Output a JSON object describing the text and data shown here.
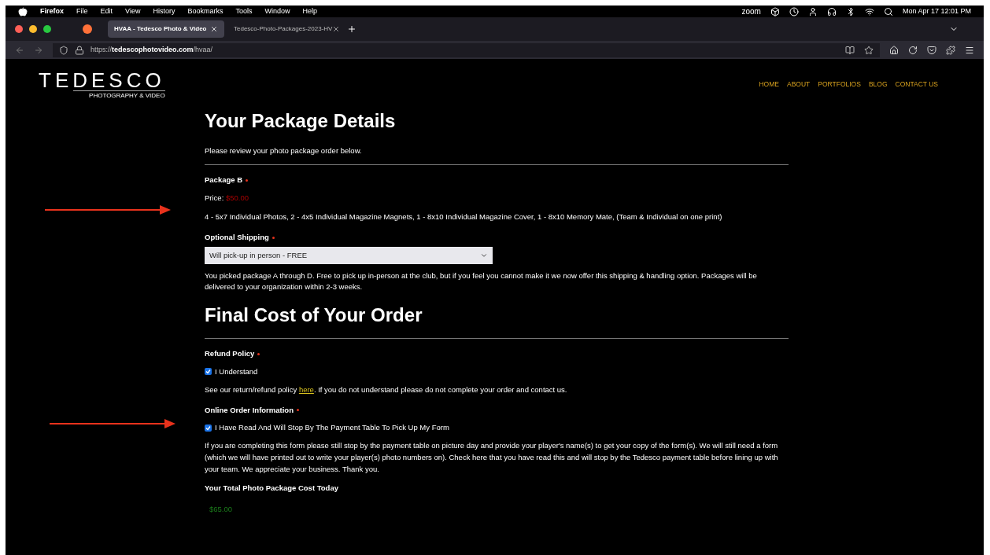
{
  "menu_bar": {
    "app": "Firefox",
    "items": [
      "File",
      "Edit",
      "View",
      "History",
      "Bookmarks",
      "Tools",
      "Window",
      "Help"
    ],
    "status_text": "zoom",
    "clock": "Mon Apr 17  12:01 PM"
  },
  "tabs": [
    {
      "label": "HVAA - Tedesco Photo & Video",
      "selected": true
    },
    {
      "label": "Tedesco-Photo-Packages-2023-HV",
      "selected": false
    }
  ],
  "address_bar": {
    "scheme": "https://",
    "domain": "tedescophotovideo.com",
    "path": "/hvaa/"
  },
  "site": {
    "logo": "TEDESCO",
    "tagline": "PHOTOGRAPHY & VIDEO",
    "nav": [
      "HOME",
      "ABOUT",
      "PORTFOLIOS",
      "BLOG",
      "CONTACT US"
    ]
  },
  "package_section": {
    "title": "Your Package Details",
    "intro": "Please review your photo package order below.",
    "package_label": "Package B",
    "price_label": "Price:",
    "price": "$50.00",
    "contents": "4 - 5x7 Individual Photos, 2 - 4x5 Individual Magazine Magnets, 1 - 8x10 Individual Magazine Cover, 1 - 8x10 Memory Mate, (Team & Individual on one print)",
    "shipping_label": "Optional Shipping",
    "shipping_value": "Will pick-up in person - FREE",
    "shipping_note": "You picked package A through D. Free to pick up in-person at the club, but if you feel you cannot make it we now offer this shipping & handling option. Packages will be delivered to your organization within 2-3 weeks."
  },
  "final_section": {
    "title": "Final Cost of Your Order",
    "groups": [
      {
        "label": "Refund Policy",
        "checkbox": "I Understand",
        "checked": true,
        "note_before": "See our return/refund policy ",
        "link": "here",
        "note_after": ". If you do not understand please do not complete your order and contact us."
      },
      {
        "label": "Online Order Information",
        "checkbox": "I Have Read And Will Stop By The Payment Table To Pick Up My Form",
        "checked": true,
        "note_before": "If you are completing this form please still stop by the payment table on picture day and provide your player's name(s) to get your copy of the form(s). We will still need a form (which we will have printed out to write your player(s) photo numbers on). Check here that you have read this and will stop by the Tedesco payment table before lining up with your team. We appreciate your business. Thank you."
      }
    ],
    "total_label": "Your Total Photo Package Cost Today",
    "total": "$65.00"
  }
}
